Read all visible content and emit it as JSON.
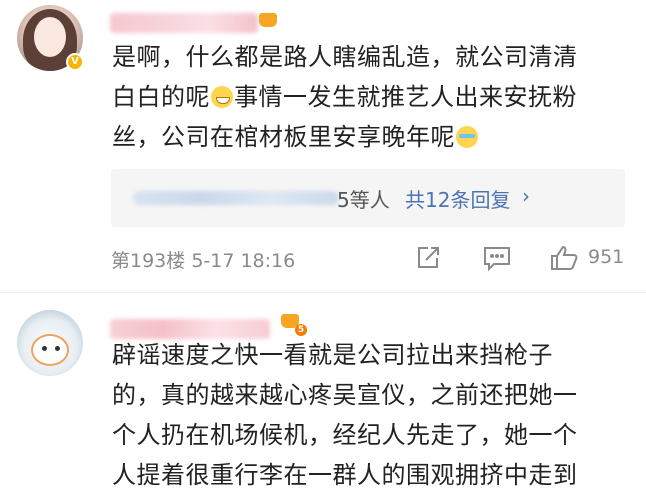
{
  "comments": [
    {
      "badge": "V",
      "lines": [
        "是啊，什么都是路人瞎编乱造，就公司清清",
        "白白的呢",
        "事情一发生就推艺人出来安抚粉",
        "丝，公司在棺材板里安享晚年呢"
      ],
      "emojis": [
        "grin-emoji",
        "cry-emoji"
      ],
      "reply_tail": "5等人",
      "reply_link": "共12条回复",
      "reply_chevron": "›",
      "floor": "第193楼",
      "time": "5-17 18:16",
      "like_count": "951"
    },
    {
      "level": "5",
      "lines": [
        "辟谣速度之快一看就是公司拉出来挡枪子",
        "的，真的越来越心疼吴宣仪，之前还把她一",
        "个人扔在机场候机，经纪人先走了，她一个",
        "人提着很重行李在一群人的围观拥挤中走到"
      ]
    }
  ],
  "colors": {
    "link": "#4a74b3",
    "meta": "#8a8a8a",
    "badge": "#f7b500"
  }
}
